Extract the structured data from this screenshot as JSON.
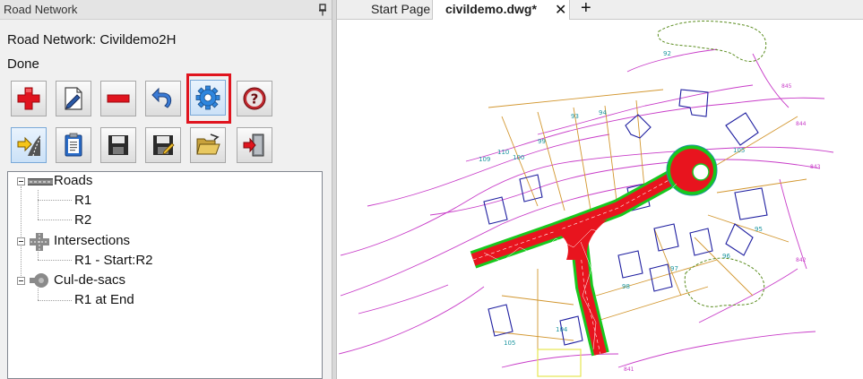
{
  "panel": {
    "title": "Road Network",
    "network_label": "Road Network: Civildemo2H",
    "status": "Done"
  },
  "toolbar": {
    "row1": [
      {
        "name": "add-icon"
      },
      {
        "name": "edit-icon"
      },
      {
        "name": "remove-icon"
      },
      {
        "name": "undo-icon"
      },
      {
        "name": "settings-gear-icon"
      },
      {
        "name": "help-icon"
      }
    ],
    "row2": [
      {
        "name": "road-import-icon"
      },
      {
        "name": "report-clipboard-icon"
      },
      {
        "name": "save-icon"
      },
      {
        "name": "save-as-icon"
      },
      {
        "name": "open-folder-icon"
      },
      {
        "name": "exit-icon"
      }
    ],
    "highlighted": "settings-gear-icon"
  },
  "tree": {
    "roads": {
      "label": "Roads",
      "children": [
        "R1",
        "R2"
      ]
    },
    "intersections": {
      "label": "Intersections",
      "children": [
        "R1 - Start:R2"
      ]
    },
    "culdesacs": {
      "label": "Cul-de-sacs",
      "children": [
        "R1 at End"
      ]
    }
  },
  "tabs": {
    "start": "Start Page",
    "active": "civildemo.dwg*",
    "close_glyph": "✕",
    "new_glyph": "+"
  },
  "drawing": {
    "lot_labels": [
      "92",
      "93",
      "94",
      "95",
      "96",
      "97",
      "98",
      "99",
      "100",
      "104",
      "105",
      "105",
      "109",
      "110"
    ],
    "contour_labels": [
      "845",
      "844",
      "843",
      "842",
      "841"
    ],
    "colors": {
      "road_fill": "#e8141e",
      "road_edge": "#18c81e",
      "lots": "#d2962e",
      "buildings": "#1e1ea0",
      "contours": "#c83cc8",
      "labels": "#1e96a0",
      "vegetation": "#5a8c1e"
    }
  }
}
